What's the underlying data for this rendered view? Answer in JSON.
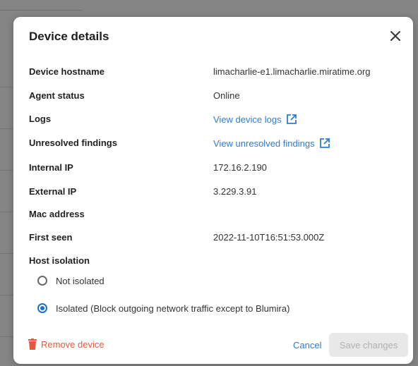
{
  "dialog": {
    "title": "Device details"
  },
  "fields": [
    {
      "label": "Device hostname",
      "value": "limacharlie-e1.limacharlie.miratime.org"
    },
    {
      "label": "Agent status",
      "value": "Online"
    },
    {
      "label": "Logs",
      "link_text": "View device logs"
    },
    {
      "label": "Unresolved findings",
      "link_text": "View unresolved findings"
    },
    {
      "label": "Internal IP",
      "value": "172.16.2.190"
    },
    {
      "label": "External IP",
      "value": "3.229.3.91"
    },
    {
      "label": "Mac address",
      "value": ""
    },
    {
      "label": "First seen",
      "value": "2022-11-10T16:51:53.000Z"
    }
  ],
  "host_isolation": {
    "label": "Host isolation",
    "options": [
      {
        "label": "Not isolated",
        "selected": false
      },
      {
        "label": "Isolated (Block outgoing network traffic except to Blumira)",
        "selected": true
      }
    ]
  },
  "footer": {
    "remove_label": "Remove device",
    "cancel_label": "Cancel",
    "save_label": "Save changes"
  },
  "icons": {
    "close": "close-icon",
    "external_link": "external-link-icon",
    "trash": "trash-icon"
  },
  "colors": {
    "link": "#2f7bd0",
    "radio_selected": "#1a6fd4",
    "danger": "#e25a3d",
    "disabled_button_bg": "#e8e8e8",
    "disabled_button_text": "#b0b0b0"
  }
}
